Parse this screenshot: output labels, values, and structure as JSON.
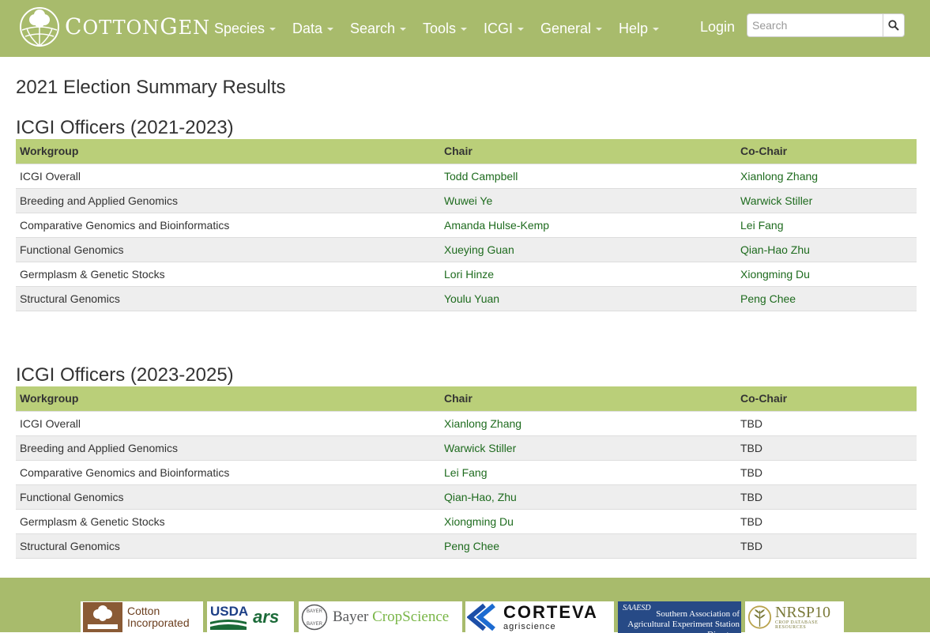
{
  "navbar": {
    "brand": {
      "first": "C",
      "rest": "OTTON",
      "first2": "G",
      "rest2": "EN"
    },
    "menu": [
      {
        "label": "Species"
      },
      {
        "label": "Data"
      },
      {
        "label": "Search"
      },
      {
        "label": "Tools"
      },
      {
        "label": "ICGI"
      },
      {
        "label": "General"
      },
      {
        "label": "Help"
      }
    ],
    "login": "Login",
    "search_placeholder": "Search"
  },
  "page": {
    "title": "2021 Election Summary Results"
  },
  "sections": [
    {
      "title": "ICGI Officers (2021-2023)",
      "columns": [
        "Workgroup",
        "Chair",
        "Co-Chair"
      ],
      "rows": [
        {
          "workgroup": "ICGI Overall",
          "chair": "Todd Campbell",
          "cochair": "Xianlong Zhang"
        },
        {
          "workgroup": "Breeding and Applied Genomics",
          "chair": "Wuwei Ye",
          "cochair": "Warwick Stiller"
        },
        {
          "workgroup": "Comparative Genomics and Bioinformatics",
          "chair": "Amanda Hulse-Kemp",
          "cochair": "Lei Fang"
        },
        {
          "workgroup": "Functional Genomics",
          "chair": "Xueying Guan",
          "cochair": "Qian-Hao Zhu"
        },
        {
          "workgroup": "Germplasm & Genetic Stocks",
          "chair": "Lori Hinze",
          "cochair": "Xiongming Du"
        },
        {
          "workgroup": "Structural Genomics",
          "chair": "Youlu Yuan",
          "cochair": "Peng Chee"
        }
      ]
    },
    {
      "title": "ICGI Officers (2023-2025)",
      "columns": [
        "Workgroup",
        "Chair",
        "Co-Chair"
      ],
      "rows": [
        {
          "workgroup": "ICGI Overall",
          "chair": "Xianlong Zhang",
          "cochair": "TBD"
        },
        {
          "workgroup": "Breeding and Applied Genomics",
          "chair": "Warwick Stiller",
          "cochair": "TBD"
        },
        {
          "workgroup": "Comparative Genomics and Bioinformatics",
          "chair": "Lei Fang",
          "cochair": "TBD"
        },
        {
          "workgroup": "Functional Genomics",
          "chair": "Qian-Hao, Zhu",
          "cochair": "TBD"
        },
        {
          "workgroup": "Germplasm & Genetic Stocks",
          "chair": "Xiongming Du",
          "cochair": "TBD"
        },
        {
          "workgroup": "Structural Genomics",
          "chair": "Peng Chee",
          "cochair": "TBD"
        }
      ]
    }
  ],
  "footer": {
    "sponsors": {
      "cotton_inc": [
        "Cotton",
        "Incorporated"
      ],
      "usda": "USDA",
      "ars": "ars",
      "bayer": [
        "Bayer",
        "CropScience"
      ],
      "bayer_cross": "BAYER",
      "corteva": "CORTEVA",
      "corteva_sub": "agriscience",
      "saaesd_abbr": "SAAESD",
      "saaesd": [
        "Southern Association of",
        "Agricultural Experiment Station Directors"
      ],
      "nrsp": "NRSP10",
      "nrsp_sub": "CROP DATABASE RESOURCES"
    }
  },
  "colors": {
    "navbar": "#a8bb6c",
    "table_header": "#bacf79",
    "link": "#1e6b1e",
    "zebra": "#eeeeee"
  }
}
